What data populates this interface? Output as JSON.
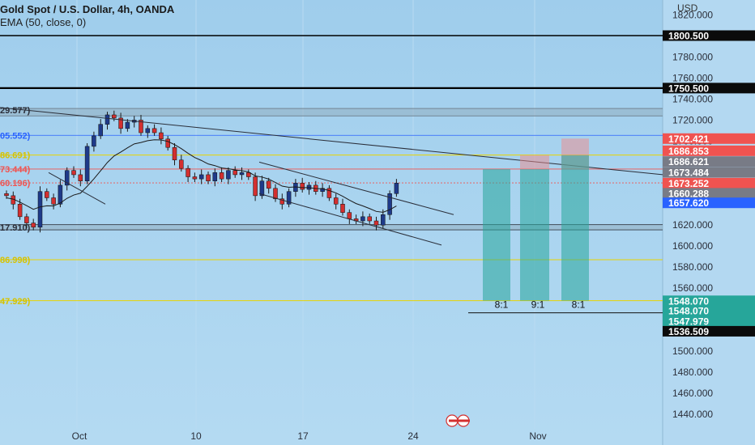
{
  "header": {
    "symbol_line": "Gold Spot / U.S. Dollar, 4h, OANDA",
    "indicator_line": "EMA (50, close, 0)"
  },
  "axis": {
    "currency": "USD",
    "ticks": [
      "1820.000",
      "1800.000",
      "1780.000",
      "1760.000",
      "1740.000",
      "1720.000",
      "1700.000",
      "1680.000",
      "1660.000",
      "1640.000",
      "1620.000",
      "1600.000",
      "1580.000",
      "1560.000",
      "1540.000",
      "1520.000",
      "1500.000",
      "1480.000",
      "1460.000",
      "1440.000"
    ],
    "x_labels": [
      "Oct",
      "10",
      "17",
      "24",
      "Nov"
    ]
  },
  "price_tags": [
    {
      "label": "1800.500",
      "color": "#0b0b0b"
    },
    {
      "label": "1750.500",
      "color": "#0b0b0b"
    },
    {
      "label": "1702.421",
      "color": "#f05350"
    },
    {
      "label": "1686.853",
      "color": "#f05350"
    },
    {
      "label": "1686.621",
      "color": "#787b86"
    },
    {
      "label": "1673.484",
      "color": "#787b86"
    },
    {
      "label": "1673.252",
      "color": "#f05350"
    },
    {
      "label": "1660.288",
      "color": "#787b86"
    },
    {
      "label": "1657.620",
      "color": "#2962ff"
    },
    {
      "label": "1548.070",
      "color": "#26a69a"
    },
    {
      "label": "1548.070",
      "color": "#26a69a"
    },
    {
      "label": "1547.979",
      "color": "#26a69a"
    },
    {
      "label": "1536.509",
      "color": "#0b0b0b"
    }
  ],
  "fib_labels": [
    {
      "text": "29.577)",
      "color": "#2a2e39"
    },
    {
      "text": "05.552)",
      "color": "#2962ff"
    },
    {
      "text": "86.691)",
      "color": "#d6c200"
    },
    {
      "text": "73.444)",
      "color": "#f05350"
    },
    {
      "text": "60.196)",
      "color": "#f05350"
    },
    {
      "text": "17.910)",
      "color": "#2a2e39"
    },
    {
      "text": "86.998)",
      "color": "#d6c200"
    },
    {
      "text": "47.929)",
      "color": "#d6c200"
    }
  ],
  "ratio_labels": [
    "8:1",
    "9:1",
    "8:1"
  ],
  "chart_data": {
    "type": "candlestick",
    "title": "Gold Spot / U.S. Dollar, 4h, OANDA",
    "ylabel": "USD",
    "ylim": [
      1428,
      1828
    ],
    "grid": true,
    "legend": "none",
    "series": [
      {
        "name": "EMA (50, close, 0)",
        "type": "line"
      }
    ],
    "close_path": [
      1648,
      1640,
      1628,
      1622,
      1618,
      1652,
      1646,
      1640,
      1658,
      1672,
      1668,
      1662,
      1695,
      1705,
      1716,
      1725,
      1722,
      1712,
      1718,
      1720,
      1708,
      1712,
      1708,
      1702,
      1694,
      1682,
      1674,
      1666,
      1664,
      1668,
      1662,
      1670,
      1664,
      1672,
      1668,
      1670,
      1666,
      1648,
      1662,
      1655,
      1645,
      1640,
      1652,
      1660,
      1654,
      1658,
      1652,
      1655,
      1646,
      1640,
      1632,
      1626,
      1624,
      1628,
      1624,
      1620,
      1630,
      1650,
      1660
    ],
    "horizontal_levels": [
      1800.5,
      1750.5,
      1729.577,
      1705.552,
      1686.691,
      1673.444,
      1660.196,
      1617.91,
      1586.998,
      1547.929
    ],
    "current_price": 1657.62,
    "target_ratios": [
      "8:1",
      "9:1",
      "8:1"
    ]
  }
}
